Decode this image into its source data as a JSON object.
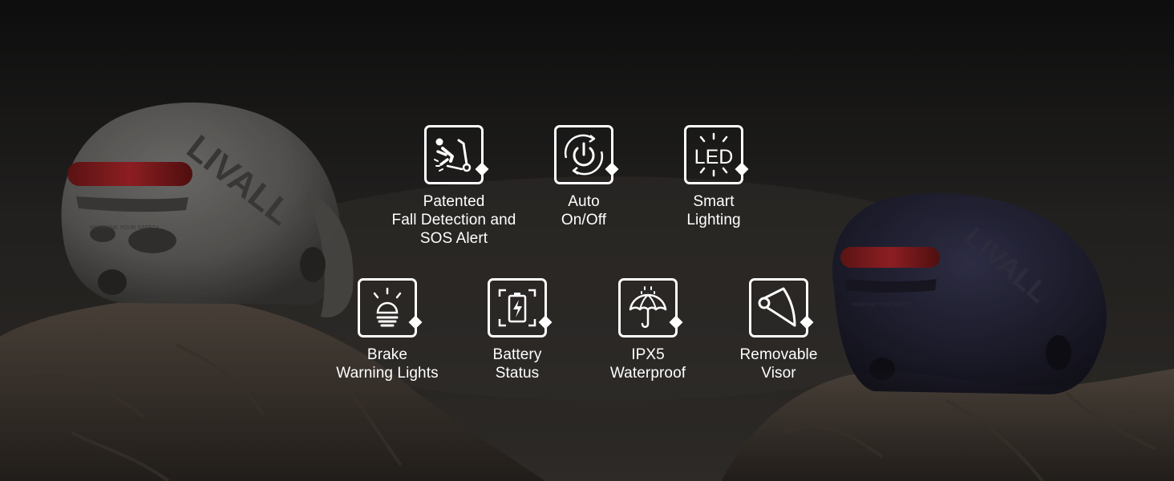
{
  "brand": {
    "helmet_logo": "LIVALL",
    "helmet_tagline": "REDEFINE YOUR SAFETY"
  },
  "features": [
    {
      "icon": "fall-detection-icon",
      "label": "Patented\nFall Detection and\nSOS Alert"
    },
    {
      "icon": "power-cycle-icon",
      "label": "Auto\nOn/Off"
    },
    {
      "icon": "led-icon",
      "label": "Smart\nLighting",
      "icon_text": "LED"
    },
    {
      "icon": "brake-light-icon",
      "label": "Brake\nWarning Lights"
    },
    {
      "icon": "battery-icon",
      "label": "Battery\nStatus"
    },
    {
      "icon": "umbrella-icon",
      "label": "IPX5\nWaterproof"
    },
    {
      "icon": "visor-icon",
      "label": "Removable\nVisor"
    }
  ],
  "colors": {
    "icon_stroke": "#ffffff",
    "taillight": "#c0272d",
    "background": "#2a2826"
  }
}
